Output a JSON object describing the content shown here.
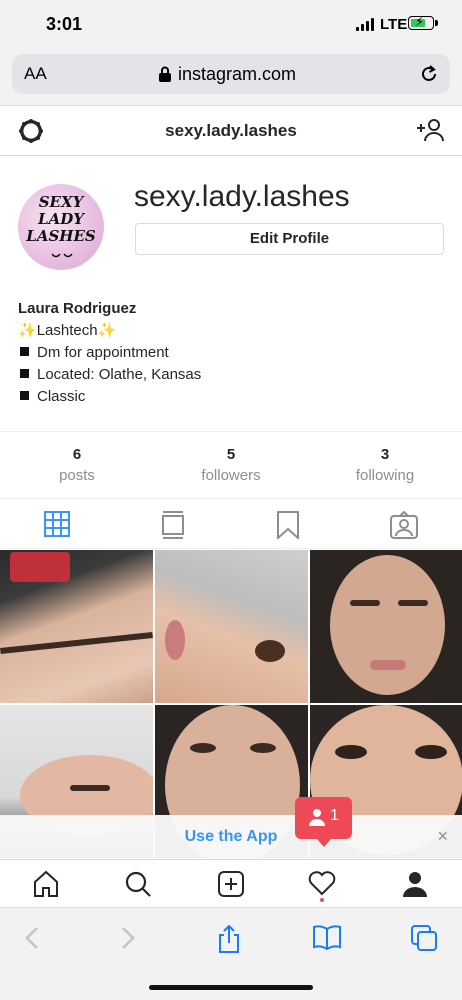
{
  "status_bar": {
    "time": "3:01",
    "network": "LTE"
  },
  "browser": {
    "text_size_label": "AA",
    "url": "instagram.com"
  },
  "header": {
    "title": "sexy.lady.lashes"
  },
  "profile": {
    "username": "sexy.lady.lashes",
    "edit_button": "Edit Profile",
    "avatar_logo_text": "SEXY LADY LASHES",
    "full_name": "Laura Rodriguez",
    "bio_title": "Lashtech",
    "bio_lines": [
      "Dm for appointment",
      "Located: Olathe, Kansas",
      "Classic"
    ]
  },
  "stats": {
    "posts": {
      "count": "6",
      "label": "posts"
    },
    "followers": {
      "count": "5",
      "label": "followers"
    },
    "following": {
      "count": "3",
      "label": "following"
    }
  },
  "tabs": [
    "grid-icon",
    "feed-icon",
    "saved-icon",
    "tagged-icon"
  ],
  "banner": {
    "text": "Use the App",
    "close": "×"
  },
  "notification": {
    "count": "1"
  },
  "accent_colors": {
    "link": "#3897f0",
    "notification": "#ed4956",
    "text": "#262626",
    "muted": "#8e8e8e"
  }
}
